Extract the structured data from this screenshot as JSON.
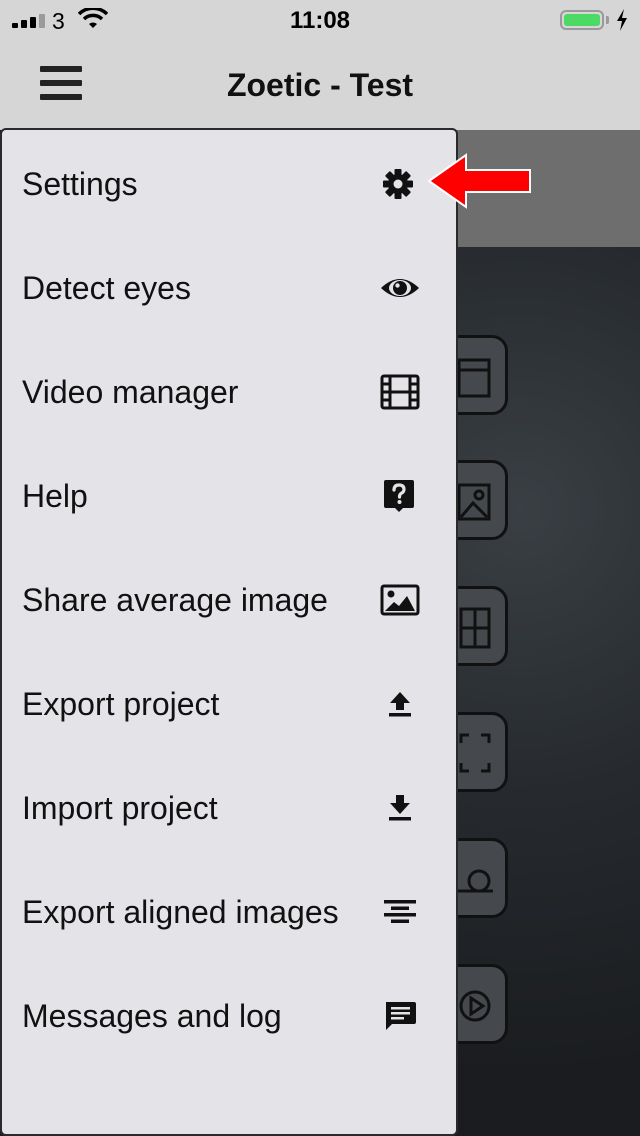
{
  "status_bar": {
    "carrier": "3",
    "time": "11:08",
    "battery_level": 0.9
  },
  "header": {
    "title": "Zoetic - Test"
  },
  "menu": {
    "items": [
      {
        "label": "Settings",
        "icon": "gear-icon"
      },
      {
        "label": "Detect eyes",
        "icon": "eye-icon"
      },
      {
        "label": "Video manager",
        "icon": "film-icon"
      },
      {
        "label": "Help",
        "icon": "help-icon"
      },
      {
        "label": "Share average image",
        "icon": "image-icon"
      },
      {
        "label": "Export project",
        "icon": "upload-icon"
      },
      {
        "label": "Import project",
        "icon": "download-icon"
      },
      {
        "label": "Export aligned images",
        "icon": "align-center-icon"
      },
      {
        "label": "Messages and log",
        "icon": "message-icon"
      }
    ]
  },
  "colors": {
    "annotation_arrow": "#ff0000",
    "battery": "#4cd964",
    "menu_background": "#e4e3e8"
  }
}
